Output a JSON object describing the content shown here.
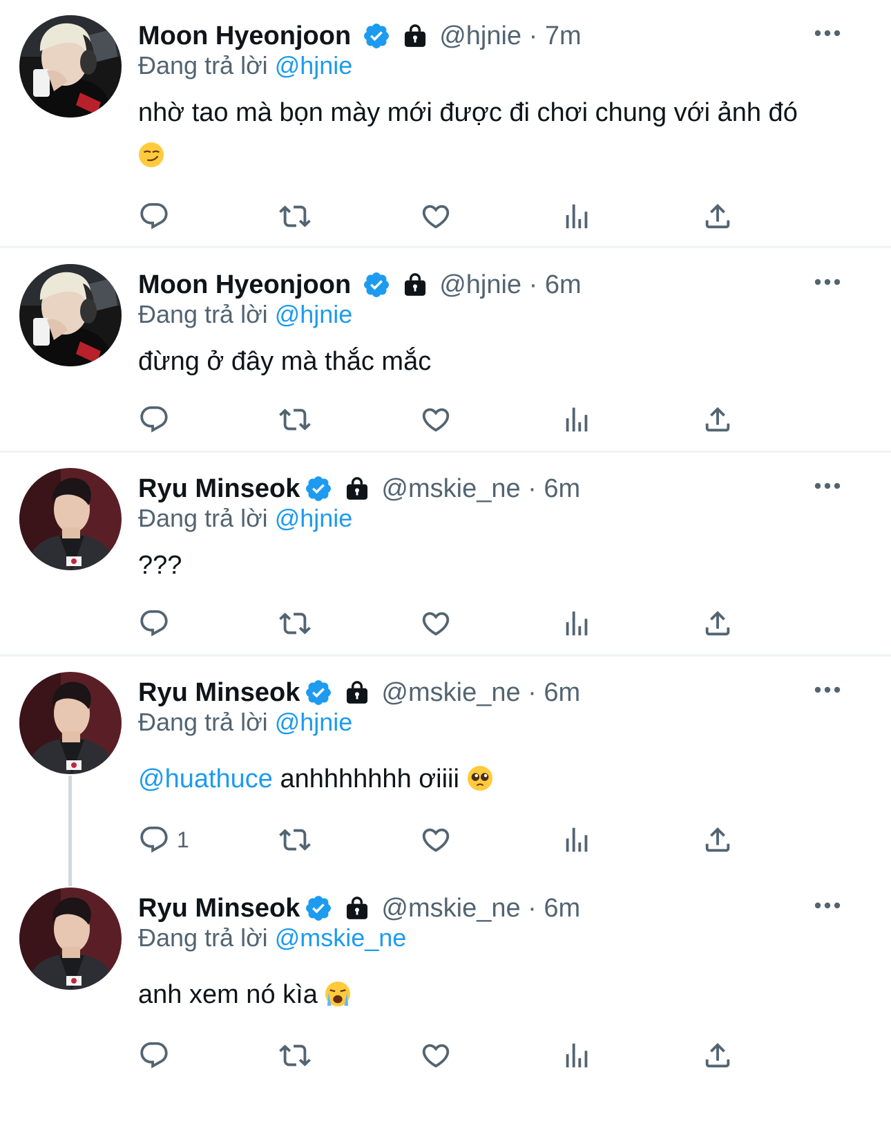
{
  "colors": {
    "accent": "#1d9bf0",
    "secondary_text": "#536471",
    "text": "#0f1419",
    "divider": "#eff3f4",
    "thread_line": "#cfd9de"
  },
  "reply_prefix": "Đang trả lời",
  "tweets": [
    {
      "name": "Moon Hyeonjoon",
      "handle_time": "@hjnie · 7m",
      "reply_to": "@hjnie",
      "text": "nhờ tao mà bọn mày mới được đi chơi chung với ảnh đó",
      "emoji": "smirking-face-emoji",
      "reply_count": ""
    },
    {
      "name": "Moon Hyeonjoon",
      "handle_time": "@hjnie · 6m",
      "reply_to": "@hjnie",
      "text": "đừng ở đây mà thắc mắc",
      "reply_count": ""
    },
    {
      "name": "Ryu Minseok",
      "handle_time": "@mskie_ne · 6m",
      "reply_to": "@hjnie",
      "text": "???",
      "reply_count": ""
    },
    {
      "name": "Ryu Minseok",
      "handle_time": "@mskie_ne · 6m",
      "reply_to": "@hjnie",
      "mention": "@huathuce",
      "text": " anhhhhhhh ơiiii",
      "emoji": "pleading-face-emoji",
      "reply_count": "1"
    },
    {
      "name": "Ryu Minseok",
      "handle_time": "@mskie_ne · 6m",
      "reply_to": "@mskie_ne",
      "text": "anh xem nó kìa",
      "emoji": "loudly-crying-face-emoji",
      "reply_count": ""
    }
  ],
  "icons": [
    "reply-icon",
    "retweet-icon",
    "like-icon",
    "views-icon",
    "share-icon",
    "verified-badge-icon",
    "shopping-bag-icon",
    "more-options-icon"
  ]
}
